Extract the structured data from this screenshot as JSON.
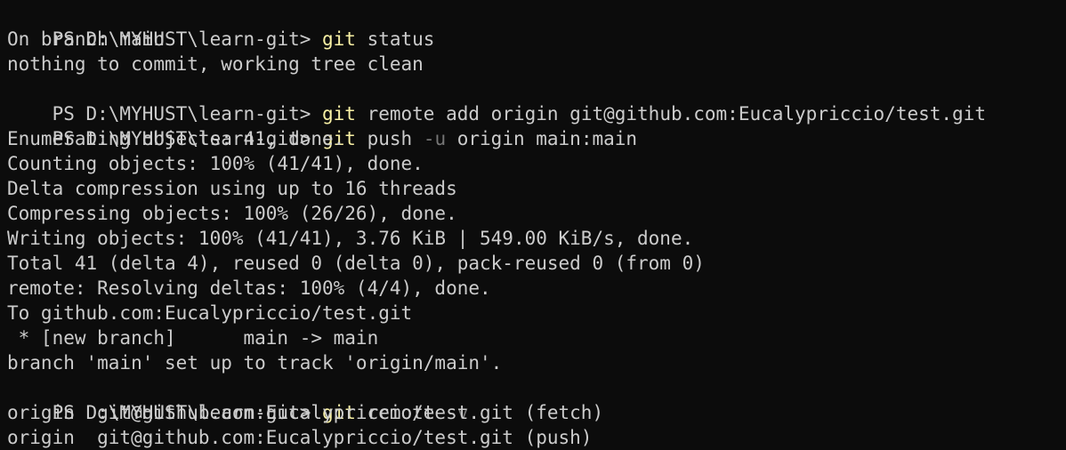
{
  "colors": {
    "background": "#0c0c0c",
    "text": "#cccccc",
    "command": "#f9f1a5",
    "flag": "#767676"
  },
  "terminal": {
    "prompt": "PS D:\\MYHUST\\learn-git> ",
    "cmd1": {
      "name": "git",
      "rest": " status"
    },
    "out1": [
      "On branch main",
      "nothing to commit, working tree clean"
    ],
    "cmd2": {
      "name": "git",
      "rest": " remote add origin git@github.com:Eucalypriccio/test.git"
    },
    "cmd3": {
      "name": "git",
      "mid": " push ",
      "flag": "-u",
      "rest": " origin main:main"
    },
    "out3": [
      "Enumerating objects: 41, done.",
      "Counting objects: 100% (41/41), done.",
      "Delta compression using up to 16 threads",
      "Compressing objects: 100% (26/26), done.",
      "Writing objects: 100% (41/41), 3.76 KiB | 549.00 KiB/s, done.",
      "Total 41 (delta 4), reused 0 (delta 0), pack-reused 0 (from 0)",
      "remote: Resolving deltas: 100% (4/4), done.",
      "To github.com:Eucalypriccio/test.git",
      " * [new branch]      main -> main",
      "branch 'main' set up to track 'origin/main'."
    ],
    "cmd4": {
      "name": "git",
      "mid": " remote ",
      "flag": "-v"
    },
    "out4": [
      "origin  git@github.com:Eucalypriccio/test.git (fetch)",
      "origin  git@github.com:Eucalypriccio/test.git (push)"
    ]
  }
}
